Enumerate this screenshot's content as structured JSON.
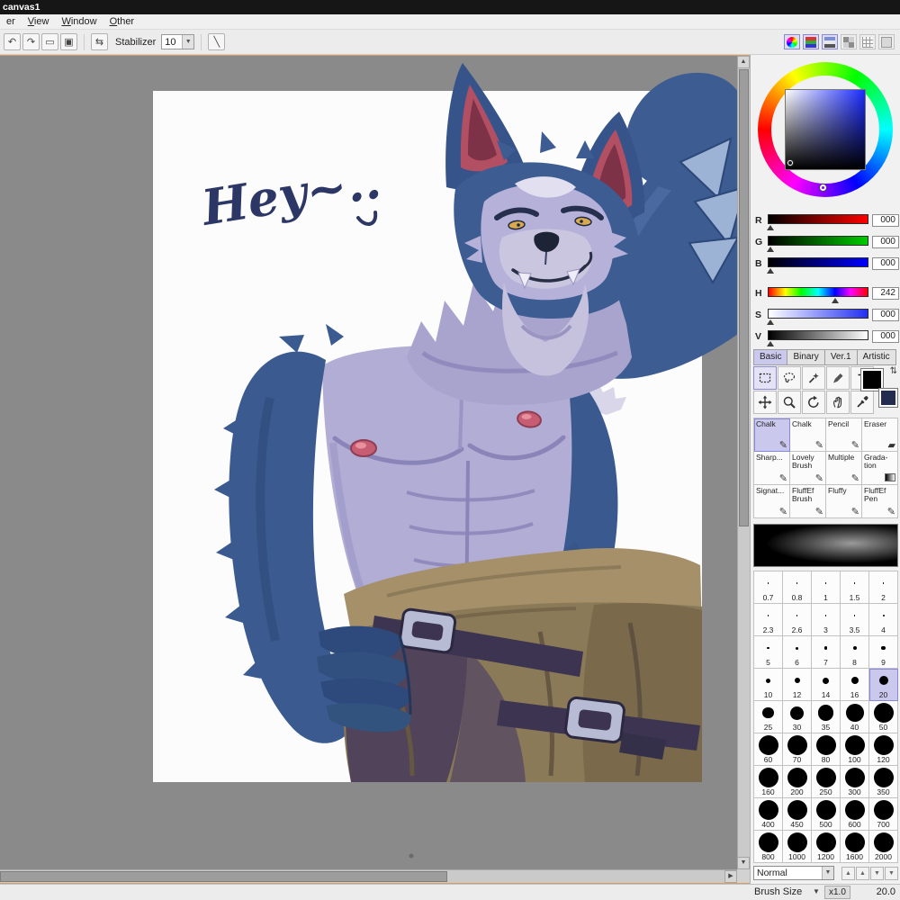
{
  "window": {
    "title": "canvas1"
  },
  "menubar": {
    "items": [
      {
        "label": "er"
      },
      {
        "label": "View"
      },
      {
        "label": "Window"
      },
      {
        "label": "Other"
      }
    ]
  },
  "toolbar": {
    "buttons": [
      {
        "name": "undo",
        "glyph": "↶"
      },
      {
        "name": "redo",
        "glyph": "↷"
      },
      {
        "name": "select-none",
        "glyph": "▭"
      },
      {
        "name": "select-invert",
        "glyph": "▣"
      }
    ],
    "flip_glyph": "⇆",
    "stabilizer": {
      "label": "Stabilizer",
      "value": "10"
    },
    "line_glyph": "╲",
    "panel_icons": [
      {
        "name": "color-wheel-panel"
      },
      {
        "name": "rgb-slider-panel"
      },
      {
        "name": "mixer-panel"
      },
      {
        "name": "swatches-panel"
      },
      {
        "name": "custom-palette-panel"
      },
      {
        "name": "scratchpad-panel"
      }
    ]
  },
  "canvas": {
    "caption": "Hey~.."
  },
  "color": {
    "primary": "#000000",
    "secondary": "#232c4e",
    "sliders": [
      {
        "label": "R",
        "value": "000",
        "type": "red",
        "marker": 2
      },
      {
        "label": "G",
        "value": "000",
        "type": "green",
        "marker": 2
      },
      {
        "label": "B",
        "value": "000",
        "type": "blue",
        "marker": 2
      },
      {
        "label": "H",
        "value": "242",
        "type": "hue",
        "marker": 67
      },
      {
        "label": "S",
        "value": "000",
        "type": "sat",
        "marker": 2
      },
      {
        "label": "V",
        "value": "000",
        "type": "val",
        "marker": 2
      }
    ]
  },
  "tool_panel": {
    "tabs": [
      {
        "label": "Basic",
        "active": true
      },
      {
        "label": "Binary",
        "active": false
      },
      {
        "label": "Ver.1",
        "active": false
      },
      {
        "label": "Artistic",
        "active": false
      }
    ],
    "tools_row1": [
      "marquee",
      "lasso",
      "magic-wand",
      "select-pen",
      "text"
    ],
    "tools_row2": [
      "move",
      "zoom",
      "rotate",
      "hand",
      "eyedropper"
    ],
    "swap_glyph": "⇅"
  },
  "brushes": {
    "selected_index": 0,
    "items": [
      {
        "label": "Chalk",
        "icon": "pencil"
      },
      {
        "label": "Chalk",
        "icon": "pencil"
      },
      {
        "label": "Pencil",
        "icon": "pencil"
      },
      {
        "label": "Eraser",
        "icon": "eraser"
      },
      {
        "label": "Sharp...",
        "icon": "pencil"
      },
      {
        "label": "Lovely Brush",
        "icon": "pencil"
      },
      {
        "label": "Multiple",
        "icon": "pencil"
      },
      {
        "label": "Grada-tion",
        "icon": "gradient"
      },
      {
        "label": "Signat...",
        "icon": "pencil"
      },
      {
        "label": "FluffEf Brush",
        "icon": "pencil"
      },
      {
        "label": "Fluffy",
        "icon": "pencil"
      },
      {
        "label": "FluffEf Pen",
        "icon": "pencil"
      }
    ]
  },
  "sizes": {
    "selected": "20",
    "values": [
      "0.7",
      "0.8",
      "1",
      "1.5",
      "2",
      "2.3",
      "2.6",
      "3",
      "3.5",
      "4",
      "5",
      "6",
      "7",
      "8",
      "9",
      "10",
      "12",
      "14",
      "16",
      "20",
      "25",
      "30",
      "35",
      "40",
      "50",
      "60",
      "70",
      "80",
      "100",
      "120",
      "160",
      "200",
      "250",
      "300",
      "350",
      "400",
      "450",
      "500",
      "600",
      "700",
      "800",
      "1000",
      "1200",
      "1600",
      "2000"
    ]
  },
  "blend": {
    "mode": "Normal",
    "order_buttons": [
      "▲",
      "▲",
      "▼",
      "▼"
    ]
  },
  "statusbar": {
    "brush_size_label": "Brush Size",
    "scale": "x1.0",
    "size_value": "20.0"
  }
}
